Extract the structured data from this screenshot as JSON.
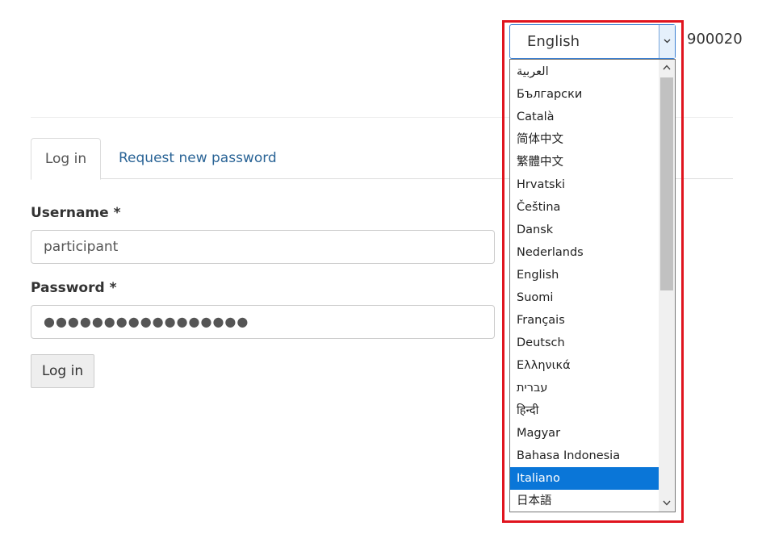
{
  "tabs": {
    "login_label": "Log in",
    "request_password_label": "Request new password"
  },
  "form": {
    "username_label": "Username *",
    "username_value": "participant",
    "password_label": "Password *",
    "password_value": "●●●●●●●●●●●●●●●●●",
    "submit_label": "Log in"
  },
  "language": {
    "selected": "English",
    "code": "900020",
    "highlighted_option": "Italiano",
    "options": [
      "العربية",
      "Български",
      "Català",
      "简体中文",
      "繁體中文",
      "Hrvatski",
      "Čeština",
      "Dansk",
      "Nederlands",
      "English",
      "Suomi",
      "Français",
      "Deutsch",
      "Ελληνικά",
      "עברית",
      "हिन्दी",
      "Magyar",
      "Bahasa Indonesia",
      "Italiano",
      "日本語"
    ]
  },
  "colors": {
    "highlight_border": "#e0141e",
    "selected_option_bg": "#0a76d8",
    "link": "#2a6496"
  },
  "icons": {
    "dropdown_arrow": "chevron-down-icon",
    "scroll_up": "chevron-up-icon",
    "scroll_down": "chevron-down-icon"
  }
}
